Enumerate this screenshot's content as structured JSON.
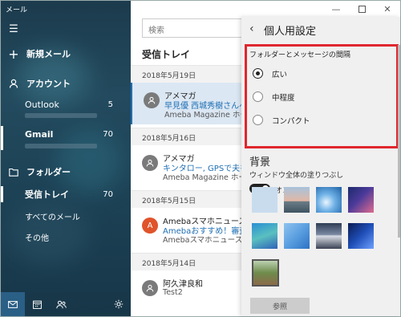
{
  "window": {
    "title": "メール",
    "controls": [
      "minimize-icon",
      "maximize-icon",
      "close-icon"
    ]
  },
  "sidebar": {
    "menu_icon": "hamburger-icon",
    "new_mail": {
      "icon": "plus-icon",
      "label": "新規メール"
    },
    "accounts_header": {
      "icon": "person-icon",
      "label": "アカウント"
    },
    "accounts": [
      {
        "name": "Outlook",
        "count": "5"
      },
      {
        "name": "Gmail",
        "count": "70"
      }
    ],
    "folders_header": {
      "icon": "folder-icon",
      "label": "フォルダー"
    },
    "folders": [
      {
        "name": "受信トレイ",
        "count": "70"
      },
      {
        "name": "すべてのメール",
        "count": ""
      },
      {
        "name": "その他",
        "count": ""
      }
    ],
    "bottom": [
      "mail-icon",
      "calendar-icon",
      "people-icon",
      "settings-icon"
    ]
  },
  "messages": {
    "search_placeholder": "検索",
    "title": "受信トレイ",
    "groups": [
      {
        "date": "2018年5月19日",
        "items": [
          {
            "from": "アメマガ",
            "subject": "早見優 西城秀樹さんへの",
            "preview": "Ameba Magazine ホームで",
            "avatar": "",
            "selected": true
          }
        ]
      },
      {
        "date": "2018年5月16日",
        "items": [
          {
            "from": "アメマガ",
            "subject": "キンタロー, GPSで夫を検索",
            "preview": "Ameba Magazine ホームで",
            "avatar": "",
            "selected": false
          }
        ]
      },
      {
        "date": "2018年5月15日",
        "items": [
          {
            "from": "Amebaスマホニュース",
            "subject": "Amebaおすすめ！審査済",
            "preview": "Amebaスマホニュース すま",
            "avatar": "A",
            "selected": false
          }
        ]
      },
      {
        "date": "2018年5月14日",
        "items": [
          {
            "from": "阿久津良和",
            "subject": "",
            "preview": "Test2",
            "avatar": "",
            "selected": false
          }
        ]
      }
    ]
  },
  "settings": {
    "back_icon": "back-arrow-icon",
    "title": "個人用設定",
    "density": {
      "title": "フォルダーとメッセージの間隔",
      "options": [
        {
          "label": "広い",
          "selected": true
        },
        {
          "label": "中程度",
          "selected": false
        },
        {
          "label": "コンパクト",
          "selected": false
        }
      ]
    },
    "background": {
      "title": "背景",
      "fill_label": "ウィンドウ全体の塗りつぶし",
      "toggle_state": "オン",
      "toggle_on": true,
      "browse_label": "参照"
    }
  },
  "colors": {
    "accent": "#1f6fb4",
    "highlight": "#e0262e",
    "sidebar": "#1f4256"
  }
}
